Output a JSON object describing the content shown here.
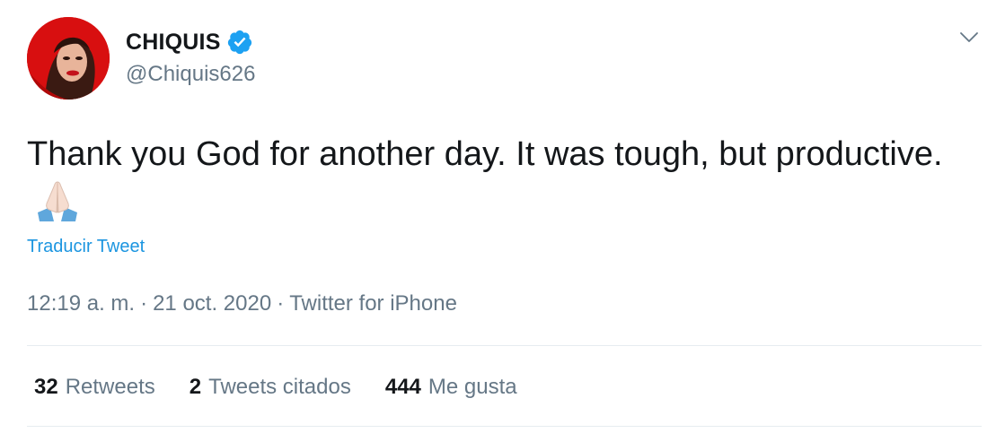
{
  "author": {
    "display_name": "CHIQUIS",
    "handle": "@Chiquis626",
    "verified": true
  },
  "tweet": {
    "text": "Thank you God for another day. It was tough, but productive.",
    "emoji": "folded-hands-icon",
    "translate_label": "Traducir Tweet",
    "time": "12:19 a. m.",
    "date": "21 oct. 2020",
    "separator": "·",
    "source": "Twitter for iPhone"
  },
  "stats": [
    {
      "count": "32",
      "label": "Retweets"
    },
    {
      "count": "2",
      "label": "Tweets citados"
    },
    {
      "count": "444",
      "label": "Me gusta"
    }
  ],
  "colors": {
    "text": "#14171a",
    "secondary": "#657786",
    "link": "#1b95e0",
    "verified": "#1da1f2",
    "divider": "#e6ecf0"
  }
}
